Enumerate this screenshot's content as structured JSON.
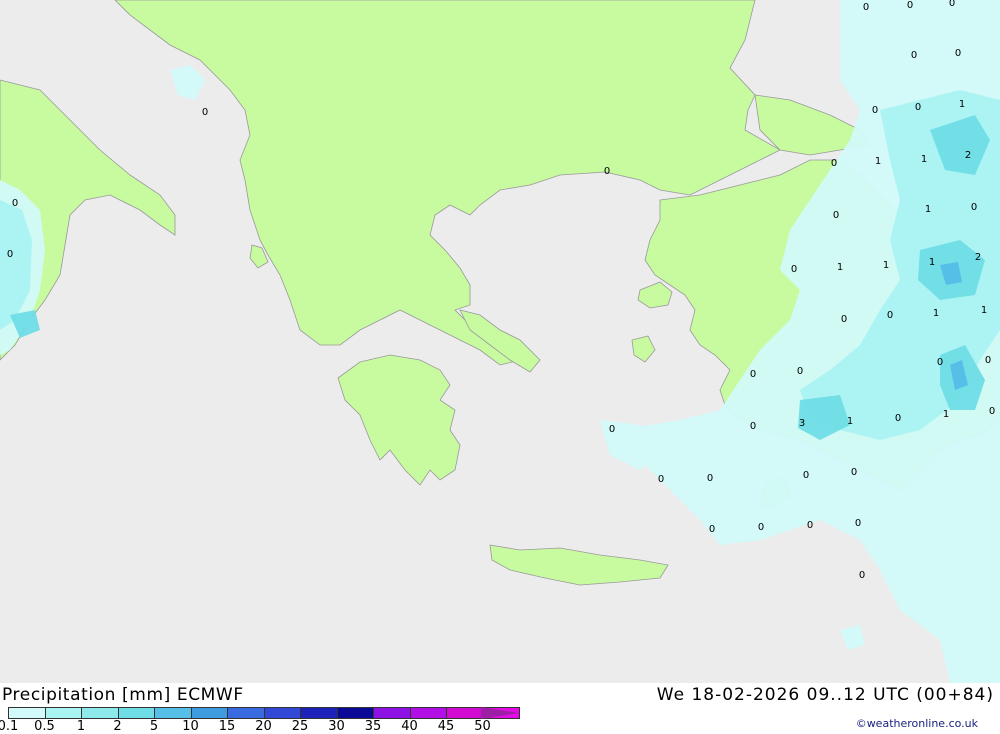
{
  "title": "Precipitation [mm] ECMWF",
  "datetime": "We 18-02-2026 09..12 UTC (00+84)",
  "credit": "©weatheronline.co.uk",
  "colors": {
    "sea": "#ececec",
    "land": "#c8fba0",
    "border": "#888888",
    "coast": "#999999"
  },
  "legend": {
    "ticks": [
      "0.1",
      "0.5",
      "1",
      "2",
      "5",
      "10",
      "15",
      "20",
      "25",
      "30",
      "35",
      "40",
      "45",
      "50"
    ],
    "colors": [
      "#d2fafa",
      "#aaf3f3",
      "#8eeaea",
      "#6fdde6",
      "#55bfe8",
      "#3e9be0",
      "#3a6ae0",
      "#3248d6",
      "#1d22b8",
      "#0a0a96",
      "#8e12e6",
      "#b20ee6",
      "#d20ad2",
      "#e60ae6"
    ],
    "arrow_color": "#9c1fa6"
  },
  "map_labels": [
    {
      "text": "0"
    },
    {
      "text": "0"
    },
    {
      "text": "0"
    },
    {
      "text": "0"
    },
    {
      "text": "0"
    },
    {
      "text": "0"
    },
    {
      "text": "1"
    },
    {
      "text": "0"
    },
    {
      "text": "1"
    },
    {
      "text": "1"
    },
    {
      "text": "2"
    },
    {
      "text": "0"
    },
    {
      "text": "0"
    },
    {
      "text": "1"
    },
    {
      "text": "0"
    },
    {
      "text": "0"
    },
    {
      "text": "0"
    },
    {
      "text": "0"
    },
    {
      "text": "0"
    },
    {
      "text": "2"
    },
    {
      "text": "1"
    },
    {
      "text": "1"
    },
    {
      "text": "1"
    },
    {
      "text": "0"
    },
    {
      "text": "0"
    },
    {
      "text": "1"
    },
    {
      "text": "1"
    },
    {
      "text": "0"
    },
    {
      "text": "0"
    },
    {
      "text": "0"
    },
    {
      "text": "3"
    },
    {
      "text": "1"
    },
    {
      "text": "0"
    },
    {
      "text": "1"
    },
    {
      "text": "0"
    },
    {
      "text": "0"
    },
    {
      "text": "0"
    },
    {
      "text": "0"
    },
    {
      "text": "0"
    },
    {
      "text": "0"
    },
    {
      "text": "0"
    },
    {
      "text": "0"
    },
    {
      "text": "0"
    },
    {
      "text": "0"
    },
    {
      "text": "0"
    },
    {
      "text": "0"
    },
    {
      "text": "0"
    },
    {
      "text": "0"
    }
  ]
}
